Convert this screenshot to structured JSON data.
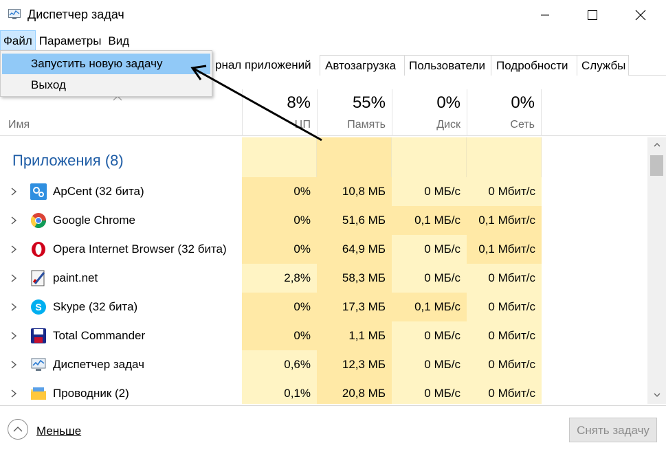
{
  "window": {
    "title": "Диспетчер задач",
    "icon": "task-manager-icon"
  },
  "menu": {
    "items": [
      "Файл",
      "Параметры",
      "Вид"
    ],
    "open_menu": {
      "items": [
        "Запустить новую задачу",
        "Выход"
      ],
      "highlighted_index": 0
    }
  },
  "tabs": {
    "visible_partial": "рнал приложений",
    "items": [
      "Автозагрузка",
      "Пользователи",
      "Подробности",
      "Службы"
    ]
  },
  "header": {
    "name_label": "Имя",
    "columns": [
      {
        "percent": "8%",
        "label": "ЦП"
      },
      {
        "percent": "55%",
        "label": "Память"
      },
      {
        "percent": "0%",
        "label": "Диск"
      },
      {
        "percent": "0%",
        "label": "Сеть"
      }
    ]
  },
  "group": {
    "title": "Приложения (8)"
  },
  "rows": [
    {
      "name": "ApCent (32 бита)",
      "icon": "apcent-gear-icon",
      "cpu": "0%",
      "mem": "10,8 МБ",
      "disk": "0 МБ/с",
      "net": "0 Мбит/с"
    },
    {
      "name": "Google Chrome",
      "icon": "chrome-icon",
      "cpu": "0%",
      "mem": "51,6 МБ",
      "disk": "0,1 МБ/с",
      "net": "0,1 Мбит/с"
    },
    {
      "name": "Opera Internet Browser (32 бита)",
      "icon": "opera-icon",
      "cpu": "0%",
      "mem": "64,9 МБ",
      "disk": "0 МБ/с",
      "net": "0,1 Мбит/с"
    },
    {
      "name": "paint.net",
      "icon": "paintnet-icon",
      "cpu": "2,8%",
      "mem": "58,3 МБ",
      "disk": "0 МБ/с",
      "net": "0 Мбит/с"
    },
    {
      "name": "Skype (32 бита)",
      "icon": "skype-icon",
      "cpu": "0%",
      "mem": "17,3 МБ",
      "disk": "0,1 МБ/с",
      "net": "0 Мбит/с"
    },
    {
      "name": "Total Commander",
      "icon": "floppy-disk-icon",
      "cpu": "0%",
      "mem": "1,1 МБ",
      "disk": "0 МБ/с",
      "net": "0 Мбит/с"
    },
    {
      "name": "Диспетчер задач",
      "icon": "task-manager-icon",
      "cpu": "0,6%",
      "mem": "12,3 МБ",
      "disk": "0 МБ/с",
      "net": "0 Мбит/с"
    },
    {
      "name": "Проводник (2)",
      "icon": "folder-icon",
      "cpu": "0,1%",
      "mem": "20,8 МБ",
      "disk": "0 МБ/с",
      "net": "0 Мбит/с"
    }
  ],
  "footer": {
    "fewer_label": "Меньше",
    "end_task_label": "Снять задачу"
  },
  "colors": {
    "heat_light": "#fff4c4",
    "heat_medium": "#ffe9a6",
    "heat_strong": "#ffd880",
    "group_title": "#1f5da6",
    "menu_highlight": "#91c9f7"
  }
}
